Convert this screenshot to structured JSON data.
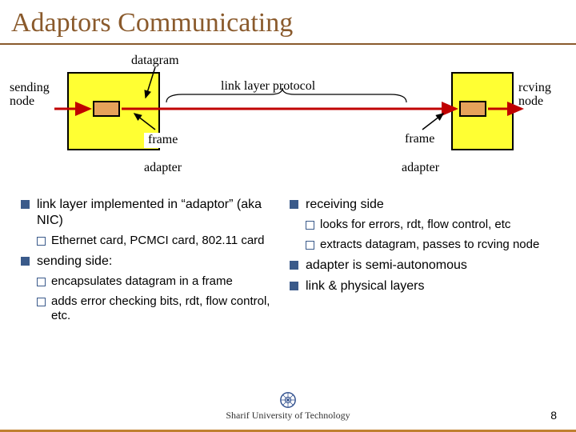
{
  "title": "Adaptors Communicating",
  "diagram": {
    "datagram": "datagram",
    "sending_node": "sending\nnode",
    "rcving_node": "rcving\nnode",
    "link_layer_protocol": "link layer protocol",
    "frame_left": "frame",
    "frame_right": "frame",
    "adapter_left": "adapter",
    "adapter_right": "adapter"
  },
  "left_col": {
    "item1": "link layer implemented in “adaptor” (aka NIC)",
    "item1_sub1": "Ethernet card, PCMCI card, 802.11 card",
    "item2": "sending side:",
    "item2_sub1": "encapsulates datagram in a frame",
    "item2_sub2": "adds error checking bits, rdt, flow control, etc."
  },
  "right_col": {
    "item1": "receiving side",
    "item1_sub1": "looks for errors, rdt, flow control, etc",
    "item1_sub2": "extracts datagram, passes to rcving node",
    "item2": "adapter is semi-autonomous",
    "item3": "link & physical layers"
  },
  "footer": "Sharif University of Technology",
  "pagenum": "8"
}
